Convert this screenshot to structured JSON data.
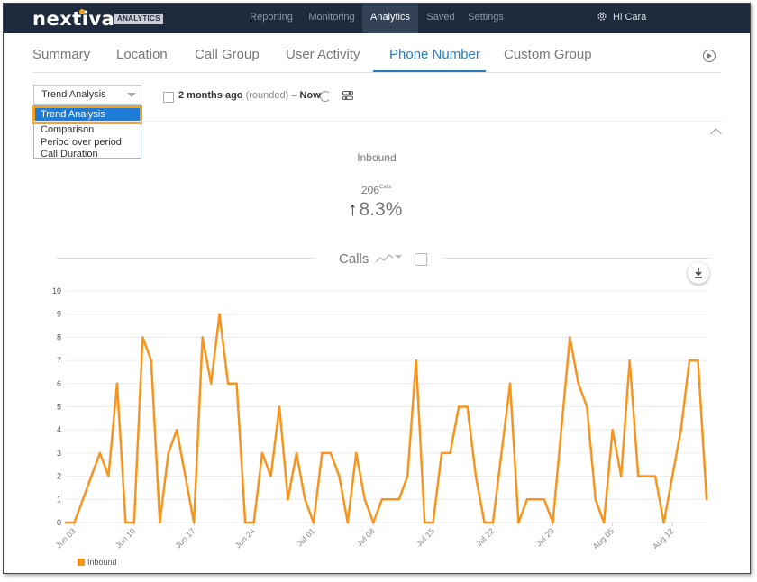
{
  "logo": {
    "name": "nextiva",
    "badge": "ANALYTICS"
  },
  "topnav": {
    "items": [
      {
        "label": "Reporting"
      },
      {
        "label": "Monitoring"
      },
      {
        "label": "Analytics"
      },
      {
        "label": "Saved"
      },
      {
        "label": "Settings"
      }
    ],
    "active": "Analytics",
    "user_label": "Hi Cara",
    "user_icon": "gear-icon"
  },
  "tabs": {
    "items": [
      {
        "label": "Summary"
      },
      {
        "label": "Location"
      },
      {
        "label": "Call Group"
      },
      {
        "label": "User Activity"
      },
      {
        "label": "Phone Number"
      },
      {
        "label": "Custom Group"
      }
    ],
    "active": "Phone Number"
  },
  "toolbar": {
    "view_select": {
      "value": "Trend Analysis",
      "options": [
        "Trend Analysis",
        "Comparison",
        "Period over period",
        "Call Duration"
      ],
      "highlighted": "Trend Analysis"
    },
    "range": {
      "from": "2 months ago",
      "from_note": "(rounded)",
      "separator": "–",
      "to": "Now"
    }
  },
  "summary": {
    "title": "Inbound",
    "calls": "206",
    "calls_unit": "Calls",
    "change": "8.3%",
    "direction": "up"
  },
  "chart_data": {
    "type": "line",
    "title": "Calls",
    "ylim": [
      0,
      10
    ],
    "yticks": [
      "0",
      "1",
      "2",
      "3",
      "4",
      "5",
      "6",
      "7",
      "8",
      "9",
      "10"
    ],
    "xticks": [
      "Jun 03",
      "Jun 10",
      "Jun 17",
      "Jun 24",
      "Jul 01",
      "Jul 08",
      "Jul 15",
      "Jul 22",
      "Jul 29",
      "Aug 05",
      "Aug 12"
    ],
    "x_start": "Jun 02",
    "color": "#f7941d",
    "grid": true,
    "legend": "bottom-left",
    "series": [
      {
        "name": "Inbound",
        "values": [
          0,
          0,
          1,
          2,
          3,
          2,
          6,
          0,
          0,
          8,
          7,
          0,
          3,
          4,
          2,
          0,
          8,
          6,
          9,
          6,
          6,
          0,
          0,
          3,
          2,
          5,
          1,
          3,
          1,
          0,
          3,
          3,
          2,
          0,
          3,
          1,
          0,
          1,
          1,
          1,
          2,
          7,
          0,
          0,
          3,
          3,
          5,
          5,
          2,
          0,
          0,
          3,
          6,
          0,
          1,
          1,
          1,
          0,
          4,
          8,
          6,
          5,
          1,
          0,
          4,
          2,
          7,
          2,
          2,
          2,
          0,
          2,
          4,
          7,
          7,
          1
        ]
      }
    ]
  }
}
